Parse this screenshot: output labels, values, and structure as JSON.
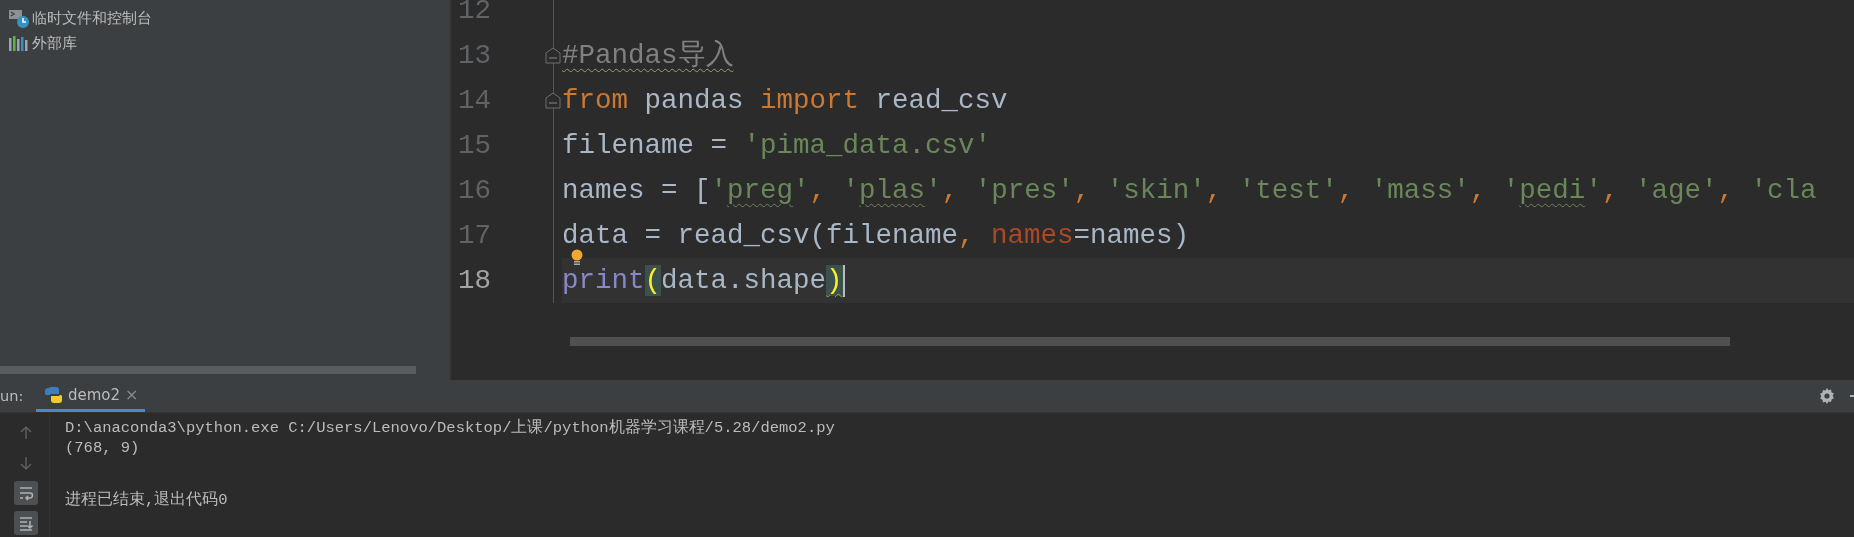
{
  "project_tree": {
    "items": [
      {
        "label": "临时文件和控制台"
      },
      {
        "label": "外部库"
      }
    ]
  },
  "editor": {
    "lines": [
      {
        "number": "12",
        "current": false,
        "fold": false,
        "bulb": false
      },
      {
        "number": "13",
        "current": false,
        "fold": true,
        "bulb": false,
        "tokens": [
          {
            "text": "#Pandas导入",
            "kind": "comment",
            "warn": true
          }
        ]
      },
      {
        "number": "14",
        "current": false,
        "fold": true,
        "bulb": false,
        "tokens": [
          {
            "text": "from",
            "kind": "keyword",
            "warn": false
          },
          {
            "text": " pandas ",
            "kind": "ident",
            "warn": false
          },
          {
            "text": "import",
            "kind": "keyword",
            "warn": false
          },
          {
            "text": " read_csv",
            "kind": "ident",
            "warn": false
          }
        ]
      },
      {
        "number": "15",
        "current": false,
        "fold": false,
        "bulb": false,
        "tokens": [
          {
            "text": "filename = ",
            "kind": "ident",
            "warn": false
          },
          {
            "text": "'pima_data.csv'",
            "kind": "string",
            "warn": false
          }
        ]
      },
      {
        "number": "16",
        "current": false,
        "fold": false,
        "bulb": false,
        "tokens": [
          {
            "text": "names = [",
            "kind": "ident",
            "warn": false
          },
          {
            "text": "'",
            "kind": "string",
            "warn": false
          },
          {
            "text": "preg",
            "kind": "string",
            "warn": true
          },
          {
            "text": "'",
            "kind": "string",
            "warn": false
          },
          {
            "text": ", ",
            "kind": "punct",
            "warn": false
          },
          {
            "text": "'",
            "kind": "string",
            "warn": false
          },
          {
            "text": "plas",
            "kind": "string",
            "warn": true
          },
          {
            "text": "'",
            "kind": "string",
            "warn": false
          },
          {
            "text": ", ",
            "kind": "punct",
            "warn": false
          },
          {
            "text": "'pres'",
            "kind": "string",
            "warn": false
          },
          {
            "text": ", ",
            "kind": "punct",
            "warn": false
          },
          {
            "text": "'skin'",
            "kind": "string",
            "warn": false
          },
          {
            "text": ", ",
            "kind": "punct",
            "warn": false
          },
          {
            "text": "'test'",
            "kind": "string",
            "warn": false
          },
          {
            "text": ", ",
            "kind": "punct",
            "warn": false
          },
          {
            "text": "'mass'",
            "kind": "string",
            "warn": false
          },
          {
            "text": ", ",
            "kind": "punct",
            "warn": false
          },
          {
            "text": "'",
            "kind": "string",
            "warn": false
          },
          {
            "text": "pedi",
            "kind": "string",
            "warn": true
          },
          {
            "text": "'",
            "kind": "string",
            "warn": false
          },
          {
            "text": ", ",
            "kind": "punct",
            "warn": false
          },
          {
            "text": "'age'",
            "kind": "string",
            "warn": false
          },
          {
            "text": ", ",
            "kind": "punct",
            "warn": false
          },
          {
            "text": "'cla",
            "kind": "string",
            "warn": false
          }
        ]
      },
      {
        "number": "17",
        "current": false,
        "fold": false,
        "bulb": true,
        "tokens": [
          {
            "text": "data = read_csv(filename",
            "kind": "ident",
            "warn": false
          },
          {
            "text": ", ",
            "kind": "punct",
            "warn": false
          },
          {
            "text": "names",
            "kind": "param",
            "warn": false
          },
          {
            "text": "=names)",
            "kind": "ident",
            "warn": false
          }
        ]
      },
      {
        "number": "18",
        "current": true,
        "fold": false,
        "bulb": false,
        "tokens": [
          {
            "text": "print",
            "kind": "builtin",
            "warn": false
          },
          {
            "text": "(",
            "kind": "brace",
            "warn": false
          },
          {
            "text": "data.shape",
            "kind": "ident",
            "warn": false
          },
          {
            "text": ")",
            "kind": "brace",
            "warn": true
          }
        ]
      }
    ]
  },
  "run_panel": {
    "label": "un:",
    "tabs": [
      {
        "label": "demo2",
        "close": "×",
        "selected": true
      }
    ],
    "console_blocks": [
      {
        "lines": [
          "D:\\anaconda3\\python.exe C:/Users/Lenovo/Desktop/上课/python机器学习课程/5.28/demo2.py",
          "(768, 9)"
        ]
      },
      {
        "lines": [
          "进程已结束,退出代码0"
        ]
      }
    ]
  }
}
